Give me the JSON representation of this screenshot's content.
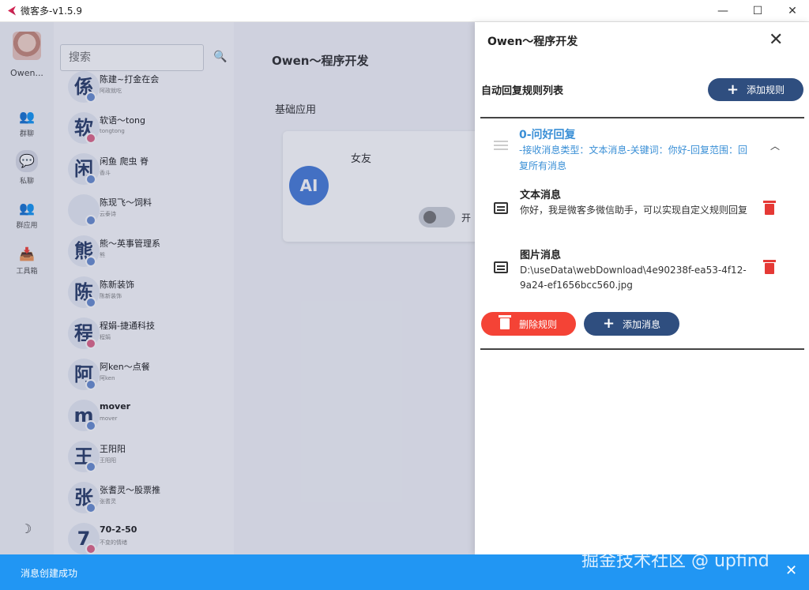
{
  "window": {
    "title": "微客多-v1.5.9",
    "controls": {
      "minimize": "—",
      "maximize": "☐",
      "close": "✕"
    }
  },
  "rail": {
    "owner": "Owen...",
    "items": [
      {
        "label": "群聊",
        "icon": "group-icon",
        "glyph": "👥"
      },
      {
        "label": "私聊",
        "icon": "chat-icon",
        "glyph": "💬"
      },
      {
        "label": "群应用",
        "icon": "group-add-icon",
        "glyph": "👥"
      },
      {
        "label": "工具箱",
        "icon": "inbox-icon",
        "glyph": "📥"
      }
    ],
    "theme_glyph": "☽"
  },
  "contacts": {
    "search_placeholder": "搜索",
    "search_glyph": "🔍",
    "items": [
      {
        "initial": "係",
        "name": "陈建~打金在会",
        "sub": "阿政就吃"
      },
      {
        "initial": "软",
        "name": "软语～tong",
        "sub": "tongtong"
      },
      {
        "initial": "闲",
        "name": "闲鱼 爬虫 脊",
        "sub": "香斗"
      },
      {
        "initial": "",
        "name": "陈现飞～饲料",
        "sub": "云泰诗"
      },
      {
        "initial": "熊",
        "name": "熊～英事管理系",
        "sub": "熊"
      },
      {
        "initial": "陈",
        "name": "陈新装饰",
        "sub": "陈新装饰"
      },
      {
        "initial": "程",
        "name": "程娟-捷通科技",
        "sub": "程娟"
      },
      {
        "initial": "阿",
        "name": "阿ken～点餐",
        "sub": "阿ken"
      },
      {
        "initial": "m",
        "name": "mover",
        "sub": "mover"
      },
      {
        "initial": "王",
        "name": "王阳阳",
        "sub": "王阳阳"
      },
      {
        "initial": "张",
        "name": "张耆灵～股票推",
        "sub": "张耆灵"
      },
      {
        "initial": "7",
        "name": "70-2-50",
        "sub": "不变的情绪"
      }
    ]
  },
  "main": {
    "title": "Owen～程序开发",
    "section": "基础应用",
    "card": {
      "avatar": "AI",
      "title": "女友",
      "toggle_label": "开"
    }
  },
  "drawer": {
    "title": "Owen～程序开发",
    "close_glyph": "✕",
    "list_title": "自动回复规则列表",
    "add_rule_label": "添加规则",
    "rule": {
      "name": "0-问好回复",
      "desc": "-接收消息类型：文本消息-关键词：你好-回复范围：回复所有消息",
      "chevron": "︿"
    },
    "messages": [
      {
        "title": "文本消息",
        "body": "你好，我是微客多微信助手，可以实现自定义规则回复"
      },
      {
        "title": "图片消息",
        "body": "D:\\useData\\webDownload\\4e90238f-ea53-4f12-9a24-ef1656bcc560.jpg"
      }
    ],
    "delete_rule_label": "删除规则",
    "add_message_label": "添加消息"
  },
  "snackbar": {
    "text": "消息创建成功",
    "close_glyph": "✕"
  },
  "watermark": "掘金技术社区 @ upfind"
}
